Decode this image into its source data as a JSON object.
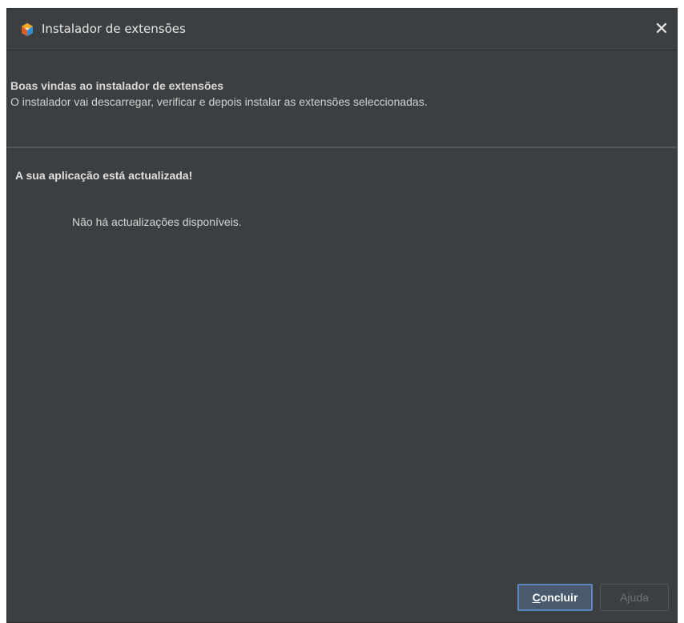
{
  "window": {
    "title": "Instalador de extensões",
    "app_icon": "app-logo-icon",
    "close_icon": "close-icon",
    "close_glyph": "✕"
  },
  "header": {
    "title": "Boas vindas ao instalador de extensões",
    "description": "O instalador vai descarregar, verificar e depois instalar as extensões seleccionadas."
  },
  "content": {
    "heading": "A sua aplicação está actualizada!",
    "message": "Não há actualizações disponíveis."
  },
  "buttons": {
    "finish_mnemonic": "C",
    "finish_rest": "oncluir",
    "help_label": "Ajuda"
  },
  "colors": {
    "background": "#3c3f41",
    "primary_button_border": "#5b86c0",
    "text": "#d8d8d8"
  }
}
